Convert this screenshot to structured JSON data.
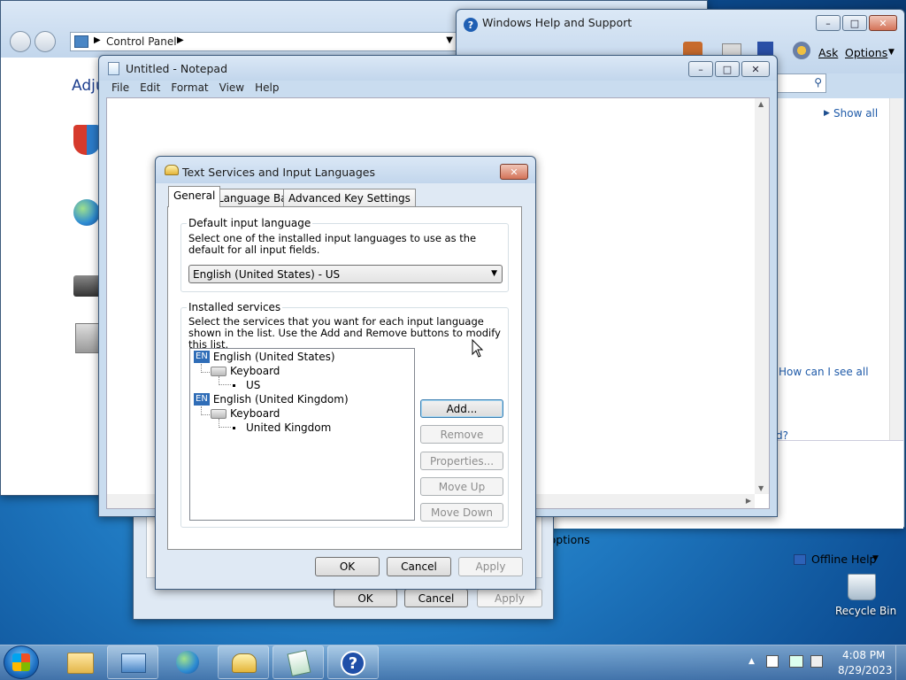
{
  "control_panel": {
    "address": "Control Panel",
    "heading": "Adju"
  },
  "help_window": {
    "title": "Windows Help and Support",
    "ask": "Ask",
    "options": "Options",
    "show_all": "Show all",
    "how_see_all": "How can I see all",
    "fragment_d": "d?",
    "fragment_options": "ort options",
    "offline_help": "Offline Help"
  },
  "notepad": {
    "title": "Untitled - Notepad",
    "menu": [
      "File",
      "Edit",
      "Format",
      "View",
      "Help"
    ]
  },
  "dialog": {
    "title": "Text Services and Input Languages",
    "tabs": [
      "General",
      "Language Bar",
      "Advanced Key Settings"
    ],
    "default_group_title": "Default input language",
    "default_desc": "Select one of the installed input languages to use as the default for all input fields.",
    "default_value": "English (United States) - US",
    "installed_group_title": "Installed services",
    "installed_desc": "Select the services that you want for each input language shown in the list. Use the Add and Remove buttons to modify this list.",
    "tree": {
      "lang1": "English (United States)",
      "lang1_badge": "EN",
      "lang1_kb": "Keyboard",
      "lang1_layout": "US",
      "lang2": "English (United Kingdom)",
      "lang2_badge": "EN",
      "lang2_kb": "Keyboard",
      "lang2_layout": "United Kingdom"
    },
    "side_buttons": {
      "add": "Add...",
      "remove": "Remove",
      "properties": "Properties...",
      "move_up": "Move Up",
      "move_down": "Move Down"
    },
    "ok": "OK",
    "cancel": "Cancel",
    "apply": "Apply"
  },
  "behind_dialog": {
    "ok": "OK",
    "cancel": "Cancel",
    "apply": "Apply"
  },
  "desktop": {
    "recycle_bin": "Recycle Bin"
  },
  "tray": {
    "time": "4:08 PM",
    "date": "8/29/2023"
  }
}
